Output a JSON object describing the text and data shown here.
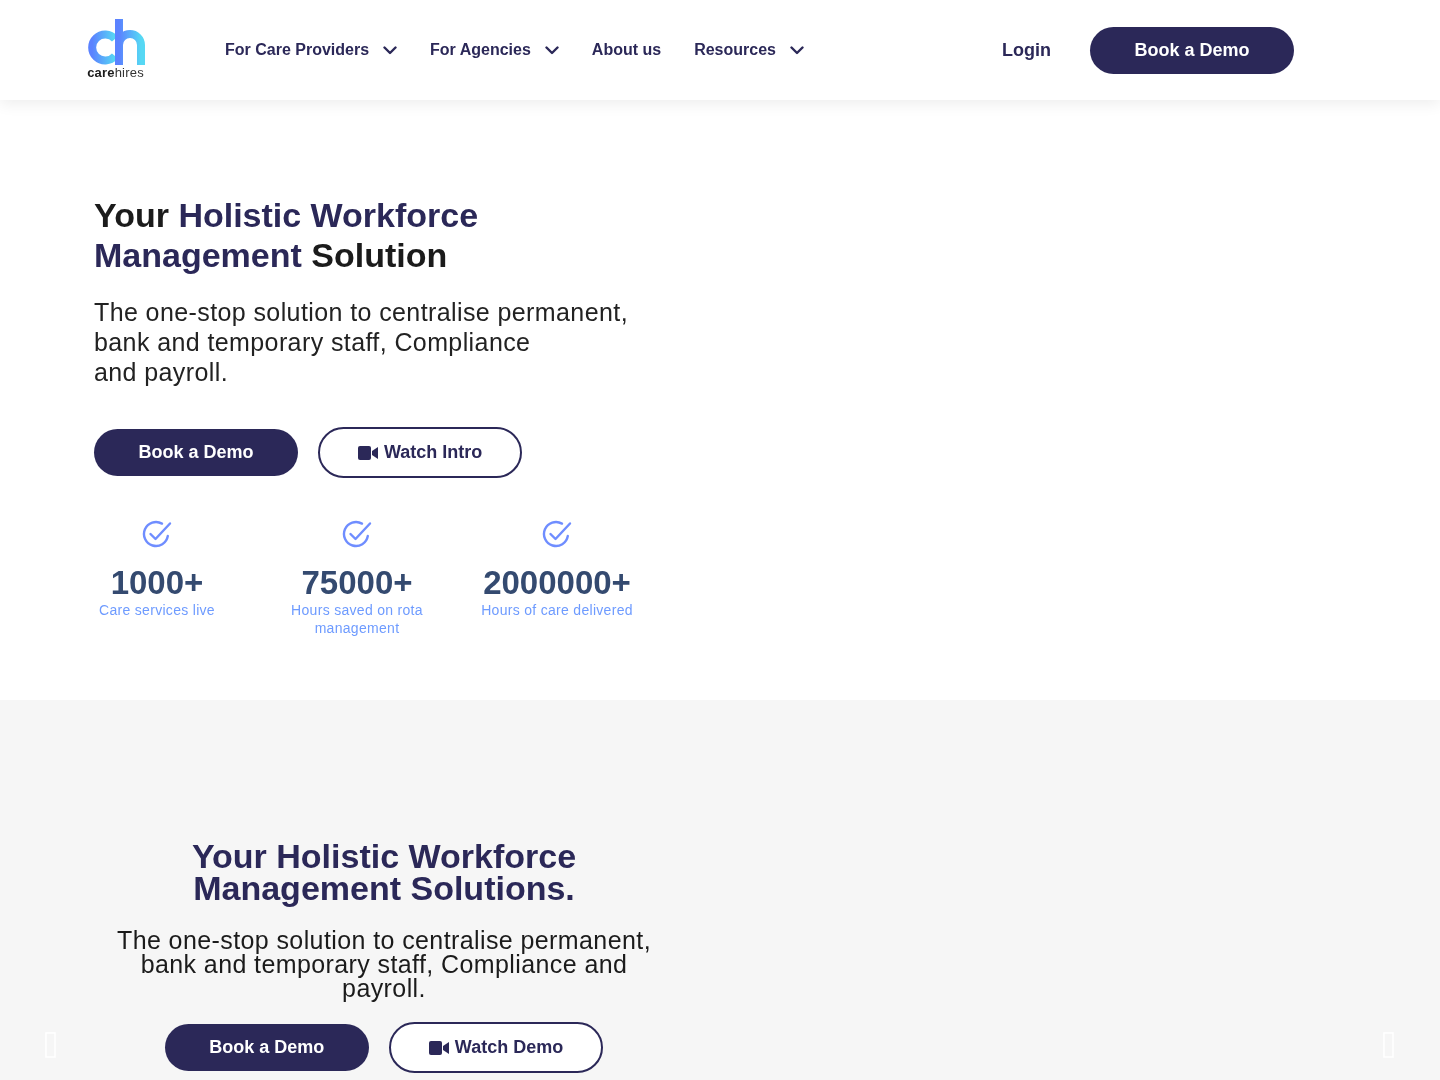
{
  "header": {
    "logo": {
      "text": "**care**hires"
    },
    "nav": [
      {
        "label": "For Care Providers",
        "has_menu": true
      },
      {
        "label": "For Agencies",
        "has_menu": true
      },
      {
        "label": "About us",
        "has_menu": false
      },
      {
        "label": "Resources",
        "has_menu": true
      }
    ],
    "login": "Login",
    "cta": "Book a Demo"
  },
  "hero": {
    "heading": [
      {
        "text": "Your ",
        "accent": false
      },
      {
        "text": "Holistic Workforce Management",
        "accent": true
      },
      {
        "text": " Solution",
        "accent": false
      }
    ],
    "text": "The one-stop solution to centralise permanent,\nbank and temporary staff, Compliance\nand payroll.",
    "buttons": [
      {
        "label": "Book a Demo",
        "kind": "primary"
      },
      {
        "label": "Watch Intro",
        "kind": "video"
      }
    ],
    "stats": [
      {
        "value": "1000+",
        "label": "Care services live"
      },
      {
        "value": "75000+",
        "label": "Hours saved on rota management"
      },
      {
        "value": "2000000+",
        "label": "Hours of care delivered"
      }
    ]
  },
  "slide": {
    "heading": "Your Holistic Workforce Management Solutions.",
    "text": "The one-stop solution to centralise permanent, bank and temporary staff, Compliance and payroll.",
    "buttons": [
      {
        "label": "Book a Demo",
        "kind": "primary"
      },
      {
        "label": "Watch Demo",
        "kind": "video"
      }
    ]
  }
}
